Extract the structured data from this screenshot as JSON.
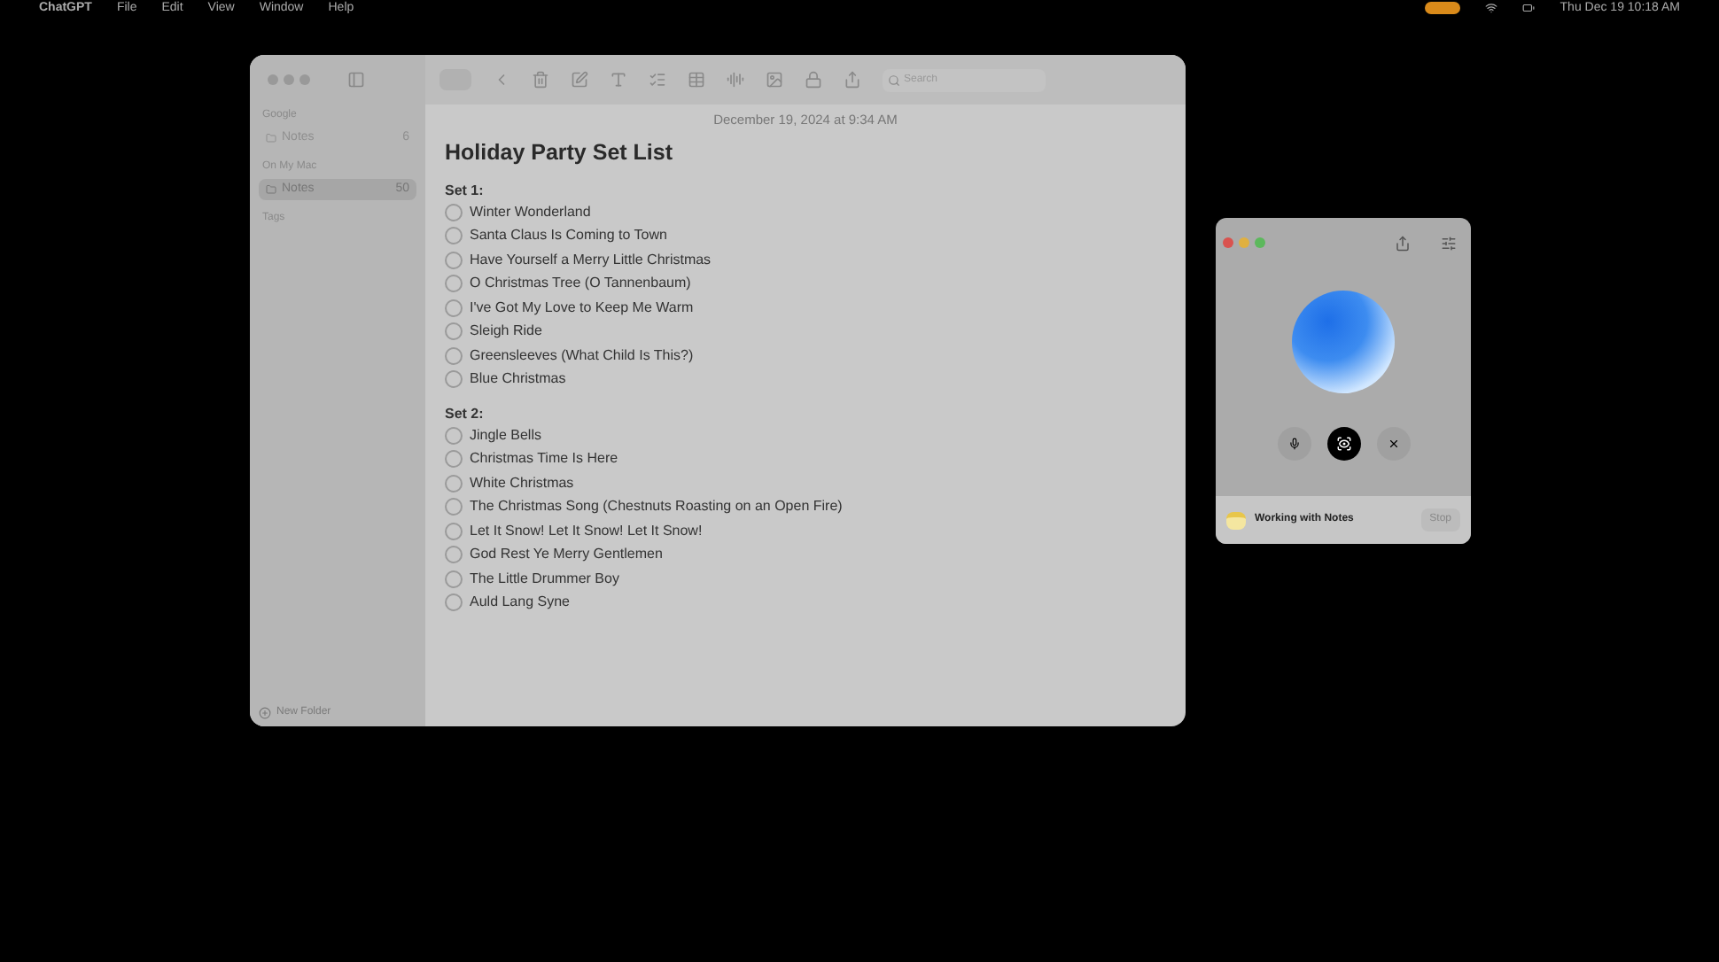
{
  "menu_bar": {
    "app": "ChatGPT",
    "items": [
      "File",
      "Edit",
      "View",
      "Window",
      "Help"
    ],
    "clock": "Thu Dec 19  10:18 AM"
  },
  "notes_window": {
    "toolbar": {
      "view_toggle": {
        "selected": true
      },
      "search": {
        "placeholder": "Search"
      }
    },
    "sidebar": {
      "sections": [
        {
          "heading": "Google",
          "folders": [
            {
              "name": "Notes",
              "count": "6",
              "selected": false
            }
          ]
        },
        {
          "heading": "On My Mac",
          "folders": [
            {
              "name": "Notes",
              "count": "50",
              "selected": true
            }
          ]
        },
        {
          "heading": "Tags"
        }
      ],
      "new_folder": "New Folder"
    },
    "note": {
      "date": "December 19, 2024 at 9:34 AM",
      "title": "Holiday Party Set List",
      "sections": [
        {
          "heading": "Set 1:",
          "items": [
            {
              "text": "Winter Wonderland",
              "checked": false
            },
            {
              "text": "Santa Claus Is Coming to Town",
              "checked": false
            },
            {
              "text": "Have Yourself a Merry Little Christmas",
              "checked": false
            },
            {
              "text": "O Christmas Tree (O Tannenbaum)",
              "checked": false
            },
            {
              "text": "I've Got My Love to Keep Me Warm",
              "checked": false
            },
            {
              "text": "Sleigh Ride",
              "checked": false
            },
            {
              "text": "Greensleeves (What Child Is This?)",
              "checked": false
            },
            {
              "text": "Blue Christmas",
              "checked": false
            }
          ]
        },
        {
          "heading": "Set 2:",
          "items": [
            {
              "text": "Jingle Bells",
              "checked": false
            },
            {
              "text": "Christmas Time Is Here",
              "checked": false
            },
            {
              "text": "White Christmas",
              "checked": false
            },
            {
              "text": "The Christmas Song (Chestnuts Roasting on an Open Fire)",
              "checked": false
            },
            {
              "text": "Let It Snow! Let It Snow! Let It Snow!",
              "checked": false
            },
            {
              "text": "God Rest Ye Merry Gentlemen",
              "checked": false
            },
            {
              "text": "The Little Drummer Boy",
              "checked": false
            },
            {
              "text": "Auld Lang Syne",
              "checked": false
            }
          ]
        }
      ]
    }
  },
  "assistant_window": {
    "status": "Working with Notes",
    "stop": "Stop"
  }
}
